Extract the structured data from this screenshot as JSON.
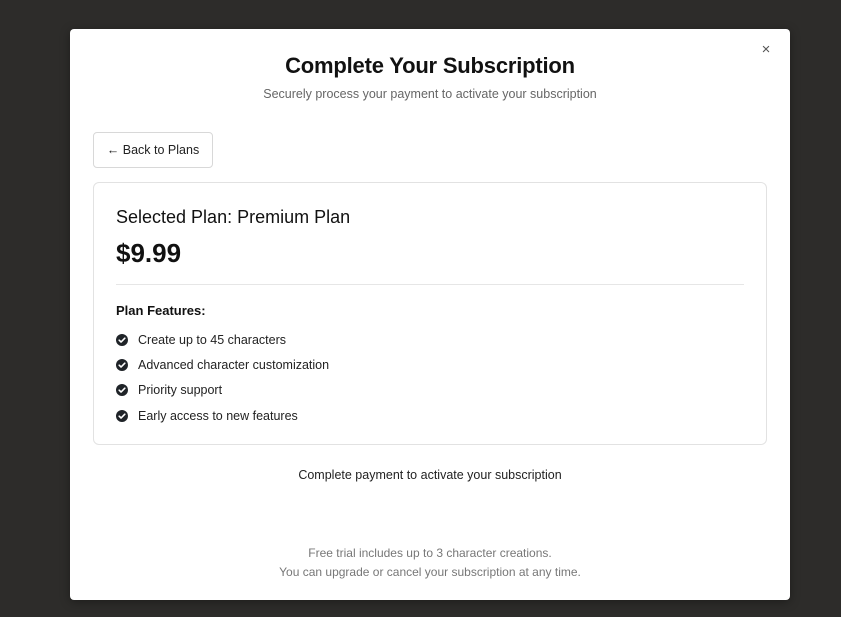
{
  "modal": {
    "close_label": "×",
    "title": "Complete Your Subscription",
    "subtitle": "Securely process your payment to activate your subscription",
    "back_button_label": "← Back to Plans"
  },
  "plan": {
    "name_label": "Selected Plan: Premium Plan",
    "price": "$9.99",
    "features_heading": "Plan Features:",
    "features": [
      {
        "label": "Create up to 45 characters",
        "icon": "check-circle-icon"
      },
      {
        "label": "Advanced character customization",
        "icon": "check-circle-icon"
      },
      {
        "label": "Priority support",
        "icon": "check-circle-icon"
      },
      {
        "label": "Early access to new features",
        "icon": "check-circle-icon"
      }
    ]
  },
  "payment_note": "Complete payment to activate your subscription",
  "footer": {
    "line1": "Free trial includes up to 3 character creations.",
    "line2": "You can upgrade or cancel your subscription at any time."
  },
  "colors": {
    "backdrop": "#2d2c2a",
    "modal_background": "#ffffff",
    "check_icon": "#1f2328"
  }
}
